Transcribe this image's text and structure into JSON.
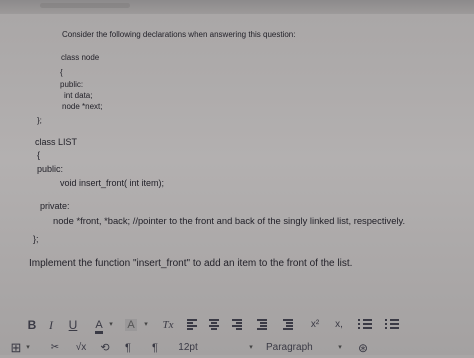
{
  "question": {
    "prompt": "Consider the following declarations when answering this question:",
    "code_node": [
      "class node",
      "{",
      "public:",
      "int data;",
      "node *next;",
      "};"
    ],
    "code_list": [
      "class LIST",
      "{",
      "public:",
      "void insert_front( int item);",
      "private:",
      "node *front, *back; //pointer to the front and back of the singly linked list, respectively.",
      "};"
    ],
    "instruction": "Implement the function \"insert_front\" to add an item to the front of the list."
  },
  "toolbar": {
    "bold": "B",
    "italic": "I",
    "underline": "U",
    "font_color": "A",
    "highlight": "A",
    "clear_format": "Tx",
    "superscript": "x²",
    "subscript": "x,",
    "table": "⊞",
    "special": "✂",
    "math": "√x",
    "link": "⟲",
    "ltr": "¶",
    "paragraph_mark": "¶",
    "font_size": "12pt",
    "block_format": "Paragraph",
    "accessibility": "⊛",
    "caret": "▾"
  }
}
